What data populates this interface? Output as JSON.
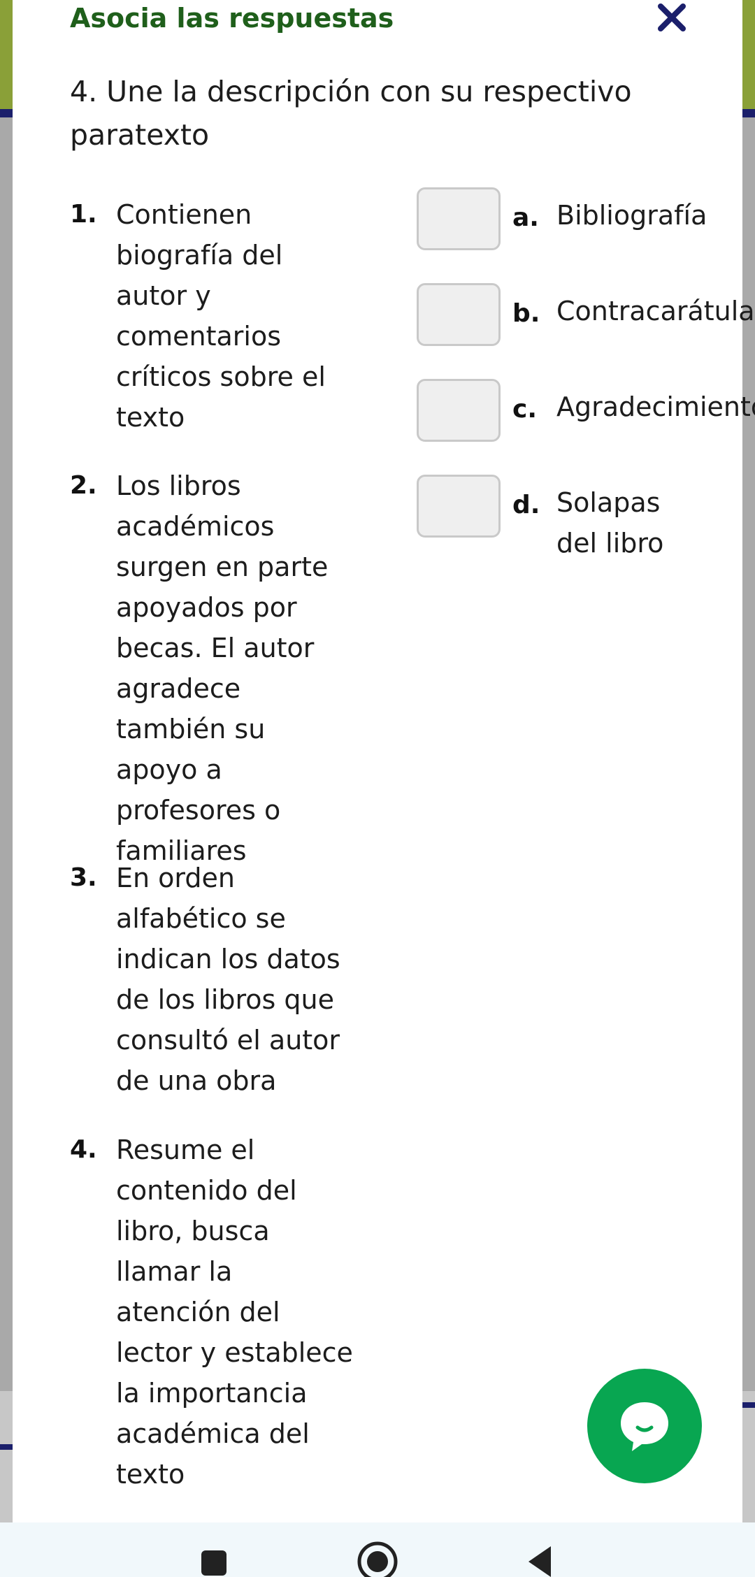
{
  "modal": {
    "title": "Asocia las respuestas",
    "close_icon": "close-icon",
    "question": "4. Une la descripción con su respectivo paratexto"
  },
  "descriptions": [
    {
      "number": "1.",
      "text": "Contienen biografía del autor y comentarios críticos sobre el texto"
    },
    {
      "number": "2.",
      "text": "Los libros académicos surgen en parte apoyados por becas. El autor agradece también su apoyo a profesores o familiares"
    },
    {
      "number": "3.",
      "text": "En orden alfabético se indican los datos de los libros que consultó el autor de una obra"
    },
    {
      "number": "4.",
      "text": "Resume el contenido del libro, busca llamar la atención del lector y establece la importancia académica del texto"
    }
  ],
  "options": [
    {
      "letter": "a.",
      "label": "Bibliografía"
    },
    {
      "letter": "b.",
      "label": "Contracarátula"
    },
    {
      "letter": "c.",
      "label": "Agradecimientos"
    },
    {
      "letter": "d.",
      "label": "Solapas del libro"
    }
  ],
  "chat_button": {
    "icon": "chat-bubble-icon"
  },
  "android_nav": {
    "icons": [
      "recents-square-icon",
      "home-circle-icon",
      "back-triangle-icon"
    ]
  },
  "colors": {
    "title": "#1f5f1b",
    "close": "#1b1f6b",
    "chat": "#08a651"
  }
}
